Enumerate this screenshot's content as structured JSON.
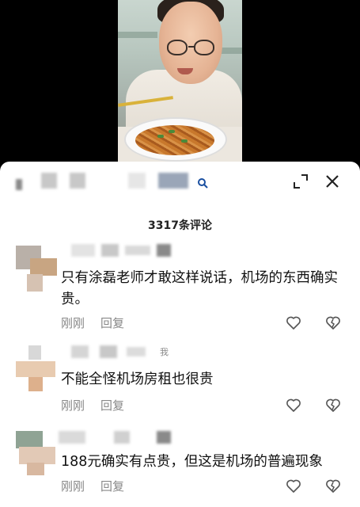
{
  "comments_panel": {
    "title": "3317条评论",
    "comments": [
      {
        "text": "只有涂磊老师才敢这样说话，机场的东西确实贵。",
        "time": "刚刚",
        "reply": "回复"
      },
      {
        "text": "不能全怪机场房租也很贵",
        "time": "刚刚",
        "reply": "回复",
        "author_tag": "我"
      },
      {
        "text": "188元确实有点贵，但这是机场的普遍现象",
        "time": "刚刚",
        "reply": "回复"
      }
    ]
  },
  "icons": {
    "search": "search-icon",
    "expand": "expand-icon",
    "close": "close-icon",
    "like": "heart-outline-icon",
    "dislike": "broken-heart-icon"
  }
}
